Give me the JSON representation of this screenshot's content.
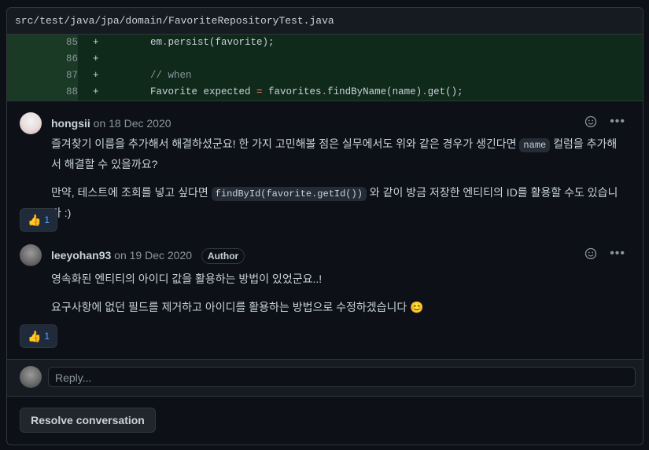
{
  "file": {
    "path": "src/test/java/jpa/domain/FavoriteRepositoryTest.java"
  },
  "diff": [
    {
      "line": "85",
      "sign": "+",
      "code_parts": [
        "em",
        ".",
        "persist(favorite);"
      ]
    },
    {
      "line": "86",
      "sign": "+",
      "code_parts": [
        "",
        "",
        ""
      ]
    },
    {
      "line": "87",
      "sign": "+",
      "code_parts": [
        "// when",
        "",
        ""
      ]
    },
    {
      "line": "88",
      "sign": "+",
      "code_parts": [
        "Favorite expected ",
        "=",
        " favorites",
        ".",
        "findByName(name)",
        ".",
        "get();"
      ]
    }
  ],
  "comments": [
    {
      "author": "hongsii",
      "date": "on 18 Dec 2020",
      "badge": "",
      "p1_a": "즐겨찾기 이름을 추가해서 해결하셨군요! 한 가지 고민해볼 점은 실무에서도 위와 같은 경우가 생긴다면 ",
      "p1_code": "name",
      "p1_b": " 컬럼을 추가해서 해결할 수 있을까요?",
      "p2_a": "만약, 테스트에 조회를 넣고 싶다면 ",
      "p2_code": "findById(favorite.getId())",
      "p2_b": " 와 같이 방금 저장한 엔티티의 ID를 활용할 수도 있습니다 :)",
      "reaction_emoji": "👍",
      "reaction_count": "1"
    },
    {
      "author": "leeyohan93",
      "date": "on 19 Dec 2020",
      "badge": "Author",
      "p1": "영속화된 엔티티의 아이디 값을 활용하는 방법이 있었군요..!",
      "p2": "요구사항에 없던 필드를 제거하고 아이디를 활용하는 방법으로 수정하겠습니다 😊",
      "reaction_emoji": "👍",
      "reaction_count": "1"
    }
  ],
  "reply": {
    "placeholder": "Reply..."
  },
  "resolve": {
    "label": "Resolve conversation"
  },
  "icons": {
    "more": "kebab-horizontal-icon",
    "react": "smiley-icon"
  },
  "colors": {
    "accent": "#58a6ff",
    "diff_add_bg": "#0f2a1b",
    "bg": "#0d1117"
  }
}
